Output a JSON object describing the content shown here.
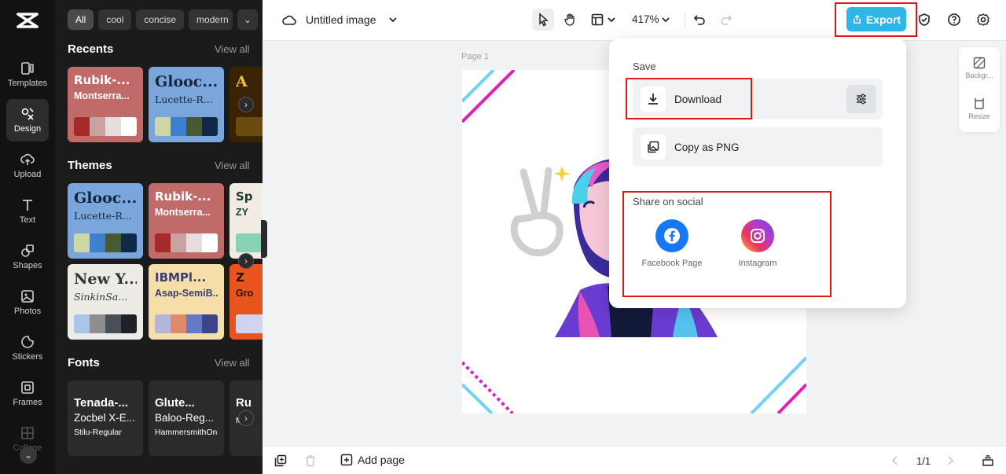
{
  "rail": {
    "items": [
      {
        "label": "Templates"
      },
      {
        "label": "Design"
      },
      {
        "label": "Upload"
      },
      {
        "label": "Text"
      },
      {
        "label": "Shapes"
      },
      {
        "label": "Photos"
      },
      {
        "label": "Stickers"
      },
      {
        "label": "Frames"
      },
      {
        "label": "Collage"
      }
    ],
    "active": "Design"
  },
  "panel": {
    "chips": [
      "All",
      "cool",
      "concise",
      "modern"
    ],
    "recents": {
      "title": "Recents",
      "view_all": "View all",
      "cards": [
        {
          "t1": "Rubik-...",
          "t2": "Montserra...",
          "bg": "#c06a6a",
          "fg": "#ffffff",
          "swatches": [
            "#a52a2a",
            "#c9a2a2",
            "#e6dede",
            "#ffffff"
          ]
        },
        {
          "t1": "Glooc...",
          "t2": "Lucette-R...",
          "bg": "#7ba6dc",
          "fg": "#13263d",
          "swatches": [
            "#cfd7a6",
            "#3f7fcf",
            "#485a30",
            "#0f2a48"
          ]
        },
        {
          "t1": "A",
          "t2": "",
          "bg": "#3a2205",
          "fg": "#f0c23b",
          "swatches": [
            "#6b4b10",
            "#6b4b10",
            "#6b4b10",
            "#6b4b10"
          ]
        }
      ]
    },
    "themes": {
      "title": "Themes",
      "view_all": "View all",
      "cards": [
        {
          "t1": "Glooc...",
          "t2": "Lucette-R...",
          "bg": "#7ba6dc",
          "fg": "#13263d",
          "swatches": [
            "#cfd7a6",
            "#3f7fcf",
            "#485a30",
            "#0f2a48"
          ]
        },
        {
          "t1": "Rubik-...",
          "t2": "Montserra...",
          "bg": "#c06a6a",
          "fg": "#ffffff",
          "swatches": [
            "#a52a2a",
            "#c9a2a2",
            "#e6dede",
            "#ffffff"
          ]
        },
        {
          "t1": "Sp",
          "t2": "ZY",
          "bg": "#f0ece2",
          "fg": "#1c3b2c",
          "swatches": [
            "#86d3b8",
            "#86d3b8",
            "#86d3b8",
            "#86d3b8"
          ]
        },
        {
          "t1": "New Y...",
          "t2": "SinkinSa...",
          "bg": "#ecebe6",
          "fg": "#333333",
          "swatches": [
            "#a9c6ea",
            "#8e8e8e",
            "#4a4e56",
            "#1f2126"
          ]
        },
        {
          "t1": "IBMPl...",
          "t2": "Asap-SemiB...",
          "bg": "#f5dea7",
          "fg": "#3b3d7a",
          "swatches": [
            "#b1b6dd",
            "#df8a6d",
            "#6579c9",
            "#3d4487"
          ]
        },
        {
          "t1": "Z",
          "t2": "Gro",
          "bg": "#e8541d",
          "fg": "#2a1208",
          "swatches": [
            "#d0d4ee",
            "#d0d4ee",
            "#d0d4ee",
            "#d0d4ee"
          ]
        }
      ]
    },
    "fonts": {
      "title": "Fonts",
      "view_all": "View all",
      "cards": [
        {
          "f1": "Tenada-...",
          "f2": "Zocbel X-E...",
          "f3": "Stilu-Regular"
        },
        {
          "f1": "Glute...",
          "f2": "Baloo-Reg...",
          "f3": "HammersmithOn..."
        },
        {
          "f1": "Ru",
          "f2": "",
          "f3": "Mon"
        }
      ]
    }
  },
  "topbar": {
    "title": "Untitled image",
    "zoom": "417%",
    "export_label": "Export"
  },
  "canvas": {
    "page_label": "Page 1"
  },
  "right_tools": {
    "background": "Backgr...",
    "resize": "Resize"
  },
  "export_popup": {
    "save_label": "Save",
    "download_label": "Download",
    "copy_label": "Copy as PNG",
    "share_label": "Share on social",
    "socials": [
      {
        "label": "Facebook Page",
        "color": "#1877f2"
      },
      {
        "label": "Instagram",
        "color": "#d6249f"
      }
    ]
  },
  "bottombar": {
    "add_page": "Add page",
    "pager": "1/1"
  },
  "colors": {
    "accent": "#2fb6e9",
    "highlight": "#e01515"
  }
}
